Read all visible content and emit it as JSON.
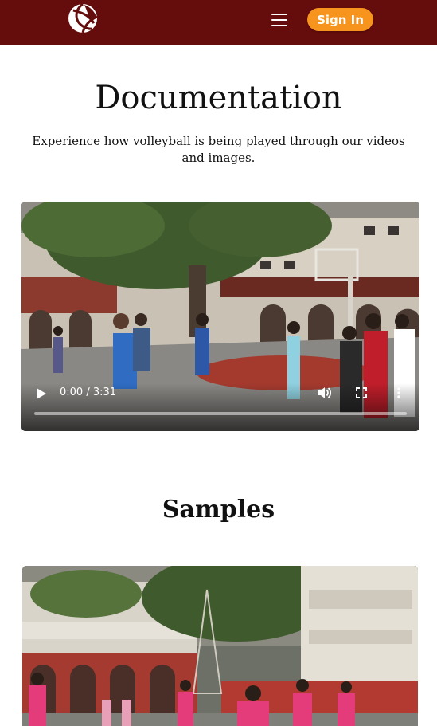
{
  "header": {
    "logo_icon": "volleyball-logo-icon",
    "menu_icon": "hamburger-menu-icon",
    "signin_label": "Sign In",
    "bar_color": "#650c0c",
    "accent_color": "#f7941d"
  },
  "documentation": {
    "title": "Documentation",
    "subtitle": "Experience how volleyball is being played through our videos and images."
  },
  "video": {
    "current_time": "0:00",
    "duration": "3:31",
    "time_display": "0:00 / 3:31",
    "progress": 0,
    "controls": [
      "play-icon",
      "volume-icon",
      "fullscreen-icon",
      "more-options-icon"
    ]
  },
  "samples": {
    "title": "Samples"
  }
}
